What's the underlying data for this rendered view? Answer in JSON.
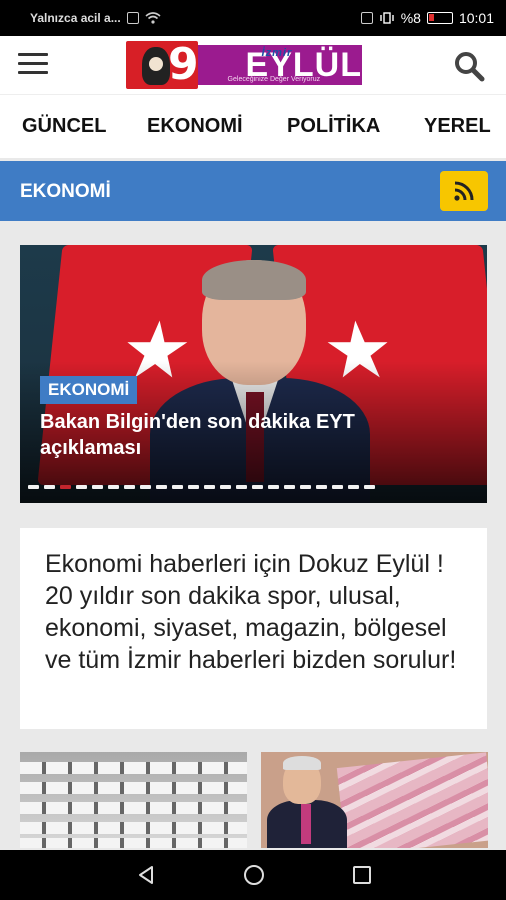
{
  "status_bar": {
    "left_text": "Yalnızca acil a...",
    "battery_text": "%8",
    "time": "10:01"
  },
  "header": {
    "logo_main": "EYLÜL",
    "logo_izmir": "İzmir",
    "logo_sub": "Geleceğinize Değer Veriyoruz",
    "menu_icon": "hamburger-menu-icon",
    "search_icon": "search-icon"
  },
  "tabs": [
    {
      "label": "GÜNCEL"
    },
    {
      "label": "EKONOMİ"
    },
    {
      "label": "POLİTİKA"
    },
    {
      "label": "YEREL"
    }
  ],
  "section": {
    "title": "EKONOMİ",
    "rss_icon": "rss-icon",
    "rss_color": "#f7c600",
    "bar_color": "#3f7cc5"
  },
  "hero": {
    "badge": "EKONOMİ",
    "title": "Bakan Bilgin'den son dakika EYT açıklaması",
    "slide_count": 22,
    "active_slide": 3
  },
  "description": {
    "text": "Ekonomi haberleri için Dokuz Eylül ! 20 yıldır son dakika spor, ulusal, ekonomi, siyaset, magazin, bölgesel ve tüm İzmir haberleri bizden sorulur!"
  },
  "nav_bar": {
    "back_icon": "back-triangle-icon",
    "home_icon": "home-circle-icon",
    "recents_icon": "recents-square-icon"
  }
}
